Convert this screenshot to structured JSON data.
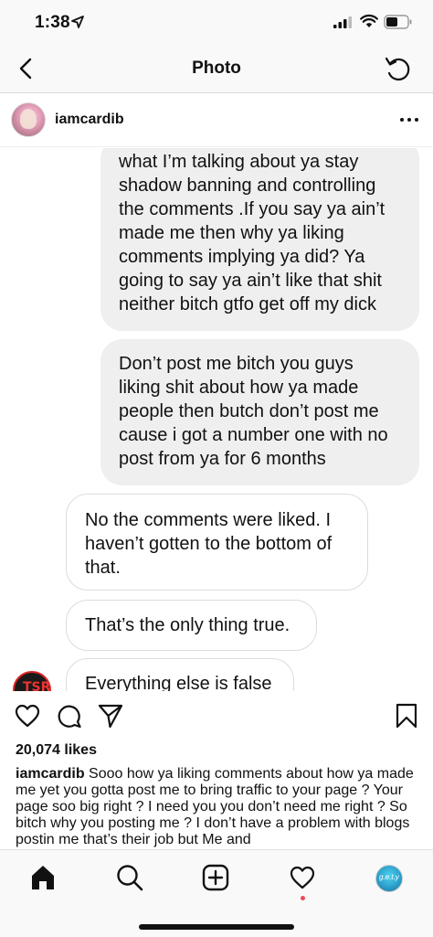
{
  "status_bar": {
    "time": "1:38",
    "icons": [
      "location-arrow-icon",
      "cellular-signal-icon",
      "wifi-icon",
      "battery-icon"
    ]
  },
  "nav": {
    "title": "Photo",
    "back_icon": "chevron-left-icon",
    "refresh_icon": "refresh-icon"
  },
  "post": {
    "username": "iamcardib",
    "more_icon": "ellipsis-icon"
  },
  "chat": {
    "messages": [
      {
        "side": "right",
        "style": "gray",
        "text": "what I’m talking about ya stay\nshadow banning and controlling\nthe comments .If you say ya ain’t\nmade me then why ya liking\ncomments implying ya did? Ya\ngoing to say ya ain’t like that shit\nneither bitch gtfo get off my dick"
      },
      {
        "side": "right",
        "style": "gray",
        "text": "Don’t post me bitch you guys\nliking shit about how ya made\npeople then butch don’t post me\ncause i got a number one with no\npost from ya for 6 months"
      },
      {
        "side": "left",
        "style": "white",
        "text": "No the comments were liked. I\nhaven’t gotten to the bottom of\nthat."
      },
      {
        "side": "left",
        "style": "white",
        "text": "That’s the only thing true."
      },
      {
        "side": "left",
        "style": "white",
        "text": "Everything else is false"
      }
    ],
    "avatar_text": "TSR"
  },
  "actions": {
    "icons": [
      "heart-icon",
      "comment-icon",
      "share-icon",
      "bookmark-icon"
    ]
  },
  "likes": "20,074 likes",
  "caption": {
    "username": "iamcardib",
    "text": " Sooo how ya liking comments about how ya made me yet you gotta post me to bring traffic to your page ? Your page soo big right ? I need you you don’t need me right ? So bitch why you posting me ? I don’t have a problem with blogs postin me that’s their job but Me and"
  },
  "tab_bar": {
    "items": [
      "home-icon",
      "search-icon",
      "add-post-icon",
      "activity-heart-icon",
      "profile-avatar"
    ],
    "profile_text": "g.e.t.y"
  }
}
